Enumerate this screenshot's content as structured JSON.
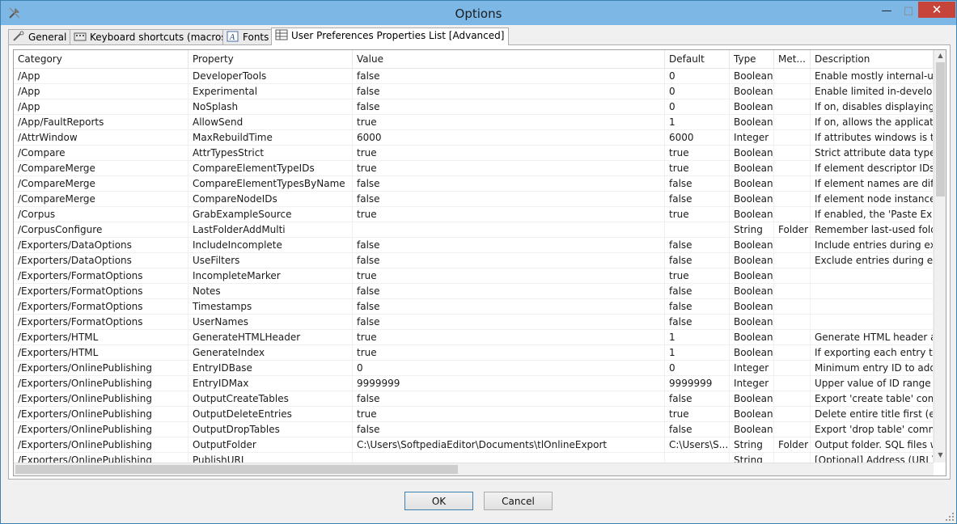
{
  "window": {
    "title": "Options"
  },
  "tabs": [
    {
      "label": "General",
      "icon": "tools-icon"
    },
    {
      "label": "Keyboard shortcuts (macros)",
      "icon": "keyboard-icon"
    },
    {
      "label": "Fonts",
      "icon": "font-icon"
    },
    {
      "label": "User Preferences Properties List [Advanced]",
      "icon": "table-icon",
      "active": true
    }
  ],
  "table": {
    "columns": [
      "Category",
      "Property",
      "Value",
      "Default",
      "Type",
      "Met...",
      "Description"
    ],
    "rows": [
      [
        "/App",
        "DeveloperTools",
        "false",
        "0",
        "Boolean",
        "",
        "Enable mostly internal-use d"
      ],
      [
        "/App",
        "Experimental",
        "false",
        "0",
        "Boolean",
        "",
        "Enable limited in-developm"
      ],
      [
        "/App",
        "NoSplash",
        "false",
        "0",
        "Boolean",
        "",
        "If on, disables displaying of"
      ],
      [
        "/App/FaultReports",
        "AllowSend",
        "true",
        "1",
        "Boolean",
        "",
        "If on, allows the application"
      ],
      [
        "/AttrWindow",
        "MaxRebuildTime",
        "6000",
        "6000",
        "Integer",
        "",
        "If attributes windows is takin"
      ],
      [
        "/Compare",
        "AttrTypesStrict",
        "true",
        "true",
        "Boolean",
        "",
        "Strict attribute data type co"
      ],
      [
        "/CompareMerge",
        "CompareElementTypeIDs",
        "true",
        "true",
        "Boolean",
        "",
        "If element descriptor IDs are"
      ],
      [
        "/CompareMerge",
        "CompareElementTypesByName",
        "false",
        "false",
        "Boolean",
        "",
        "If element names are differe"
      ],
      [
        "/CompareMerge",
        "CompareNodeIDs",
        "false",
        "false",
        "Boolean",
        "",
        "If element node instance ID"
      ],
      [
        "/Corpus",
        "GrabExampleSource",
        "true",
        "true",
        "Boolean",
        "",
        "If enabled, the 'Paste Examp"
      ],
      [
        "/CorpusConfigure",
        "LastFolderAddMulti",
        "",
        "",
        "String",
        "Folder",
        "Remember last-used folder"
      ],
      [
        "/Exporters/DataOptions",
        "IncludeIncomplete",
        "false",
        "false",
        "Boolean",
        "",
        "Include entries during expor"
      ],
      [
        "/Exporters/DataOptions",
        "UseFilters",
        "false",
        "false",
        "Boolean",
        "",
        "Exclude entries during expo"
      ],
      [
        "/Exporters/FormatOptions",
        "IncompleteMarker",
        "true",
        "true",
        "Boolean",
        "",
        ""
      ],
      [
        "/Exporters/FormatOptions",
        "Notes",
        "false",
        "false",
        "Boolean",
        "",
        ""
      ],
      [
        "/Exporters/FormatOptions",
        "Timestamps",
        "false",
        "false",
        "Boolean",
        "",
        ""
      ],
      [
        "/Exporters/FormatOptions",
        "UserNames",
        "false",
        "false",
        "Boolean",
        "",
        ""
      ],
      [
        "/Exporters/HTML",
        "GenerateHTMLHeader",
        "true",
        "1",
        "Boolean",
        "",
        "Generate HTML header and"
      ],
      [
        "/Exporters/HTML",
        "GenerateIndex",
        "true",
        "1",
        "Boolean",
        "",
        "If exporting each entry to ar"
      ],
      [
        "/Exporters/OnlinePublishing",
        "EntryIDBase",
        "0",
        "0",
        "Integer",
        "",
        "Minimum entry ID to add to"
      ],
      [
        "/Exporters/OnlinePublishing",
        "EntryIDMax",
        "9999999",
        "9999999",
        "Integer",
        "",
        "Upper value of ID range for"
      ],
      [
        "/Exporters/OnlinePublishing",
        "OutputCreateTables",
        "false",
        "false",
        "Boolean",
        "",
        "Export 'create table' comma"
      ],
      [
        "/Exporters/OnlinePublishing",
        "OutputDeleteEntries",
        "true",
        "true",
        "Boolean",
        "",
        "Delete entire title first (expo"
      ],
      [
        "/Exporters/OnlinePublishing",
        "OutputDropTables",
        "false",
        "false",
        "Boolean",
        "",
        "Export 'drop table' commar"
      ],
      [
        "/Exporters/OnlinePublishing",
        "OutputFolder",
        "C:\\Users\\SoftpediaEditor\\Documents\\tlOnlineExport",
        "C:\\Users\\S...",
        "String",
        "Folder",
        "Output folder. SQL files will"
      ],
      [
        "/Exporters/OnlinePublishing",
        "PublishURL",
        "",
        "",
        "String",
        "",
        "[Optional] Address (URL) to"
      ]
    ]
  },
  "buttons": {
    "ok": "OK",
    "cancel": "Cancel"
  }
}
